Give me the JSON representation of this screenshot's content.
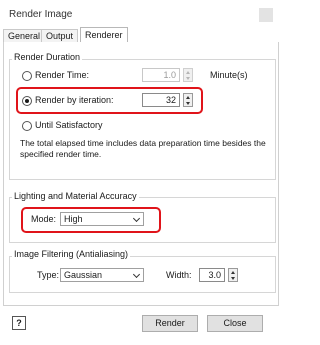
{
  "window": {
    "title": "Render Image"
  },
  "tabs": [
    {
      "label": "General",
      "active": false
    },
    {
      "label": "Output",
      "active": false
    },
    {
      "label": "Renderer",
      "active": true
    }
  ],
  "render_duration": {
    "group_label": "Render Duration",
    "render_time": {
      "label": "Render Time:",
      "value": "1.0",
      "unit": "Minute(s)",
      "selected": false
    },
    "render_by_iteration": {
      "label": "Render by iteration:",
      "value": "32",
      "selected": true
    },
    "until_satisfactory": {
      "label": "Until Satisfactory",
      "selected": false
    },
    "description": "The total elapsed time includes data preparation time besides the specified render time."
  },
  "lighting": {
    "group_label": "Lighting and Material Accuracy",
    "mode_label": "Mode:",
    "mode_value": "High"
  },
  "filtering": {
    "group_label": "Image Filtering (Antialiasing)",
    "type_label": "Type:",
    "type_value": "Gaussian",
    "width_label": "Width:",
    "width_value": "3.0"
  },
  "footer": {
    "help_glyph": "?",
    "render_label": "Render",
    "close_label": "Close"
  },
  "colors": {
    "highlight": "#e0141a"
  }
}
